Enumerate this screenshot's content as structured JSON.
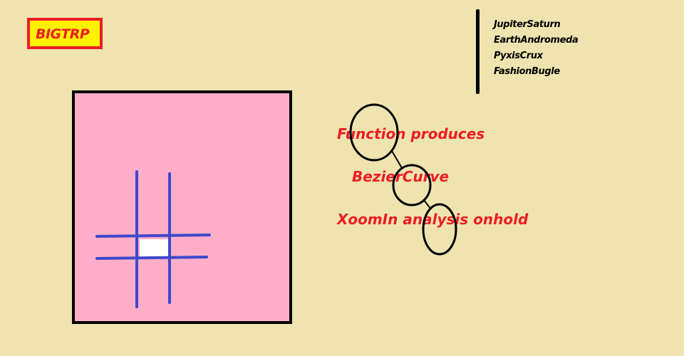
{
  "logo": {
    "text": "BIGTRP"
  },
  "name_list": [
    "JupiterSaturn",
    "EarthAndromeda",
    "PyxisCrux",
    "FashionBugle"
  ],
  "labels": {
    "line1": "Function produces",
    "line2": "BezierCurve",
    "line3": "XoomIn analysis onhold"
  },
  "colors": {
    "background": "#efe4b0",
    "panel": "#ffaec9",
    "grid_lines": "#3f48cc",
    "accent_red": "#ed1c24",
    "logo_fill": "#fff200",
    "outline": "#000000",
    "center_cell": "#ffffff"
  }
}
